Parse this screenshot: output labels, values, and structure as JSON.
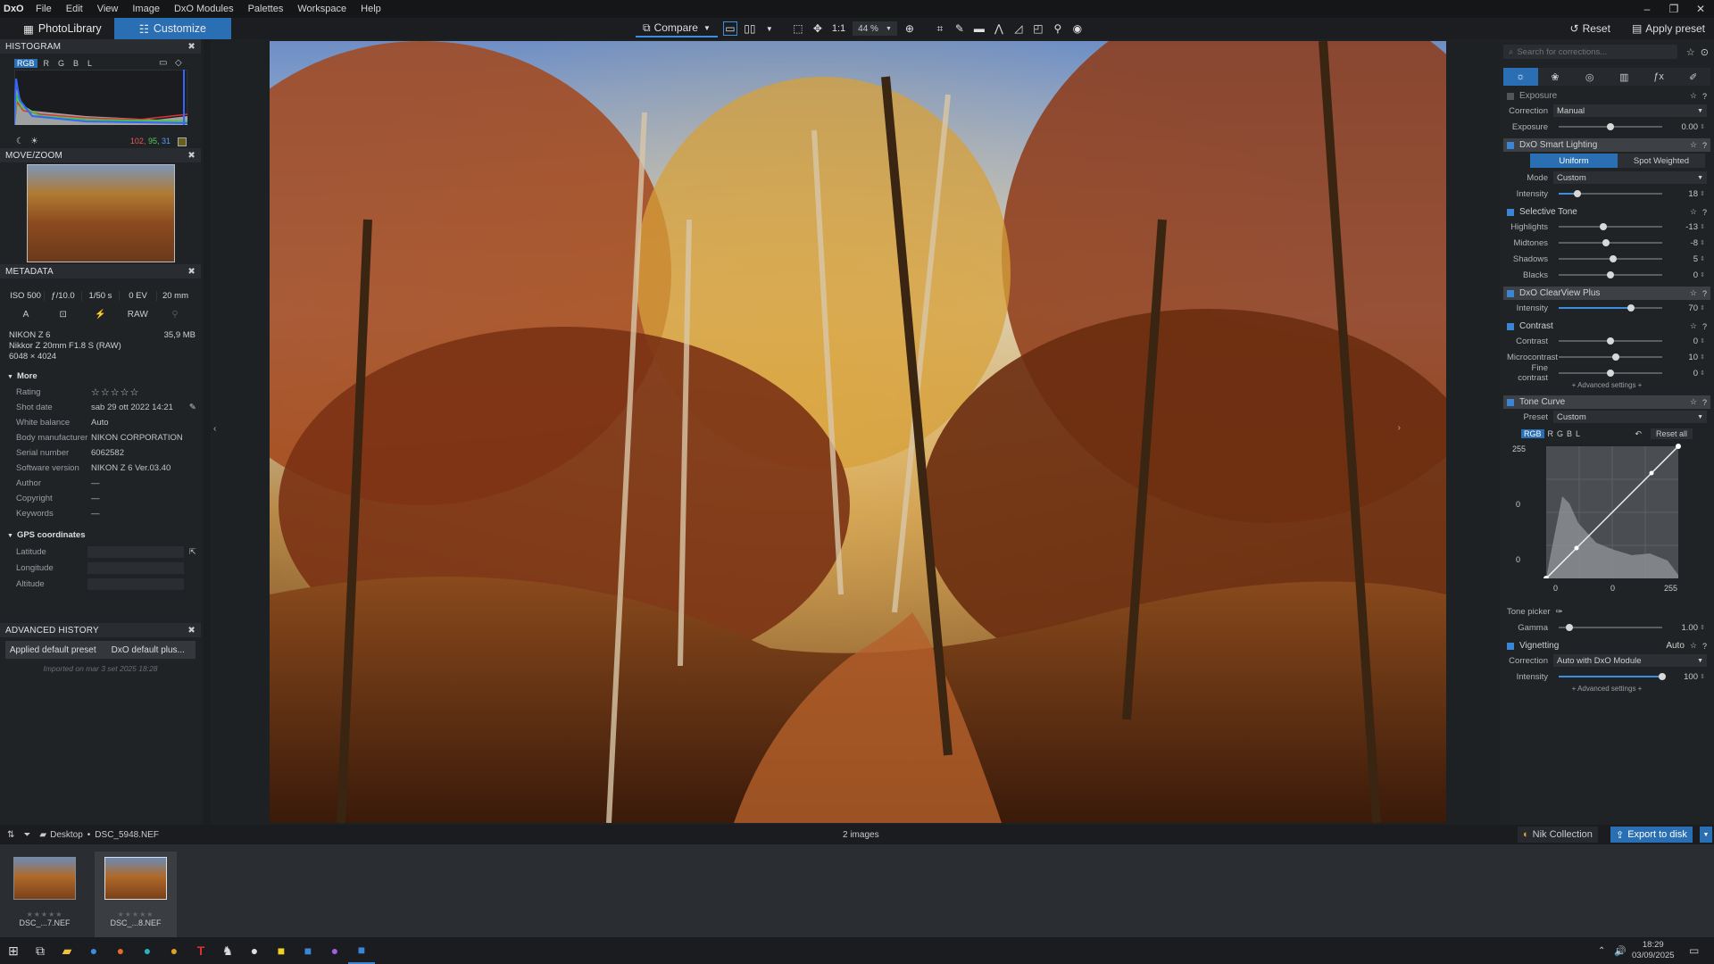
{
  "menubar": {
    "logo": "DxO",
    "items": [
      "File",
      "Edit",
      "View",
      "Image",
      "DxO Modules",
      "Palettes",
      "Workspace",
      "Help"
    ]
  },
  "toolbar": {
    "tab_photolibrary": "PhotoLibrary",
    "tab_customize": "Customize",
    "compare": "Compare",
    "one_to_one": "1:1",
    "zoom": "44 %",
    "reset": "Reset",
    "apply_preset": "Apply preset"
  },
  "histogram": {
    "title": "HISTOGRAM",
    "channels": [
      "RGB",
      "R",
      "G",
      "B",
      "L"
    ],
    "values": [
      "102,",
      "95,",
      "31"
    ]
  },
  "movezoom": {
    "title": "MOVE/ZOOM"
  },
  "metadata": {
    "title": "METADATA",
    "iso": "ISO 500",
    "aperture": "ƒ/10.0",
    "shutter": "1/50 s",
    "ev": "0 EV",
    "focal": "20 mm",
    "mode": "A",
    "raw": "RAW",
    "camera": "NIKON Z 6",
    "lens": "Nikkor Z 20mm F1.8 S (RAW)",
    "dims": "6048 × 4024",
    "filesize": "35,9 MB",
    "more_label": "More",
    "rows": [
      {
        "k": "Rating",
        "v": "☆☆☆☆☆"
      },
      {
        "k": "Shot date",
        "v": "sab 29 ott 2022 14:21"
      },
      {
        "k": "White balance",
        "v": "Auto"
      },
      {
        "k": "Body manufacturer",
        "v": "NIKON CORPORATION"
      },
      {
        "k": "Serial number",
        "v": "6062582"
      },
      {
        "k": "Software version",
        "v": "NIKON Z 6 Ver.03.40"
      },
      {
        "k": "Author",
        "v": "—"
      },
      {
        "k": "Copyright",
        "v": "—"
      },
      {
        "k": "Keywords",
        "v": "—"
      }
    ],
    "gps_label": "GPS coordinates",
    "gps": [
      "Latitude",
      "Longitude",
      "Altitude"
    ]
  },
  "history": {
    "title": "ADVANCED HISTORY",
    "item_left": "Applied default preset",
    "item_right": "DxO default plus...",
    "note": "Imported on mar 3 set 2025 18:28"
  },
  "corrections": {
    "search_placeholder": "Search for corrections...",
    "exposure": {
      "title": "Exposure",
      "correction_label": "Correction",
      "correction_value": "Manual",
      "exposure_label": "Exposure",
      "exposure_value": "0.00",
      "exposure_level": 0.5
    },
    "smart_lighting": {
      "title": "DxO Smart Lighting",
      "uniform": "Uniform",
      "spot": "Spot Weighted",
      "mode_label": "Mode",
      "mode_value": "Custom",
      "intensity_label": "Intensity",
      "intensity_value": "18",
      "intensity_level": 0.18
    },
    "selective_tone": {
      "title": "Selective Tone",
      "rows": [
        {
          "label": "Highlights",
          "value": "-13",
          "level": 0.435
        },
        {
          "label": "Midtones",
          "value": "-8",
          "level": 0.46
        },
        {
          "label": "Shadows",
          "value": "5",
          "level": 0.525
        },
        {
          "label": "Blacks",
          "value": "0",
          "level": 0.5
        }
      ]
    },
    "clearview": {
      "title": "DxO ClearView Plus",
      "intensity_label": "Intensity",
      "intensity_value": "70",
      "intensity_level": 0.7
    },
    "contrast": {
      "title": "Contrast",
      "rows": [
        {
          "label": "Contrast",
          "value": "0",
          "level": 0.5
        },
        {
          "label": "Microcontrast",
          "value": "10",
          "level": 0.55
        },
        {
          "label": "Fine contrast",
          "value": "0",
          "level": 0.5
        }
      ],
      "advanced": "+ Advanced settings +"
    },
    "tone_curve": {
      "title": "Tone Curve",
      "preset_label": "Preset",
      "preset_value": "Custom",
      "channels": [
        "RGB",
        "R",
        "G",
        "B",
        "L"
      ],
      "reset_all": "Reset all",
      "top_val": "255",
      "mid_val": "0",
      "bottom_val": "0",
      "x_left": "0",
      "x_mid": "0",
      "x_right": "255",
      "tone_picker": "Tone picker",
      "gamma_label": "Gamma",
      "gamma_value": "1.00",
      "gamma_level": 0.1
    },
    "vignetting": {
      "title": "Vignetting",
      "auto": "Auto",
      "correction_label": "Correction",
      "correction_value": "Auto with DxO Module",
      "intensity_label": "Intensity",
      "intensity_value": "100",
      "intensity_level": 1.0,
      "advanced": "+ Advanced settings +"
    }
  },
  "bottombar": {
    "path_root": "Desktop",
    "path_file": "DSC_5948.NEF",
    "count": "2 images",
    "nik": "Nik Collection",
    "export": "Export to disk"
  },
  "filmstrip": [
    {
      "name": "DSC_...7.NEF",
      "stars": "★★★★★"
    },
    {
      "name": "DSC_...8.NEF",
      "stars": "★★★★★"
    }
  ],
  "taskbar": {
    "time": "18:29",
    "date": "03/09/2025"
  }
}
